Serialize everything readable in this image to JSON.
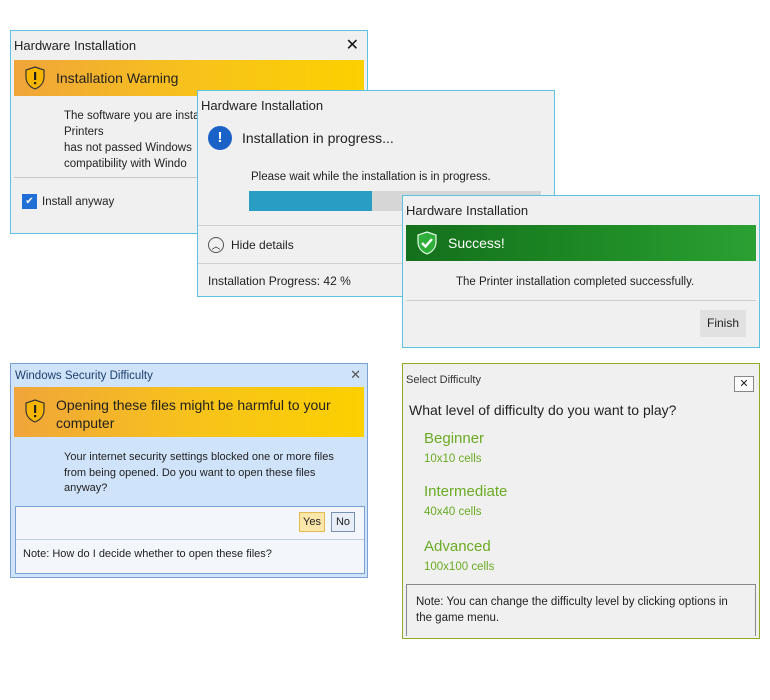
{
  "colors": {
    "warning_banner": "#f7c21c",
    "success_banner": "#1e8a25",
    "progress_fill": "#2a9dc4",
    "info_icon": "#1b62c8",
    "difficulty_accent": "#6bab24",
    "dialog_border": "#5bc3df"
  },
  "warning_dialog": {
    "title": "Hardware Installation",
    "close_icon": "close-icon",
    "banner_text": "Installation Warning",
    "banner_icon": "warning-shield-icon",
    "body_lines": [
      "The software you are insta",
      "Printers",
      "has not passed Windows",
      "compatibility with Windo"
    ],
    "checkbox_label": "Install anyway",
    "checkbox_checked": true
  },
  "progress_dialog": {
    "title": "Hardware Installation",
    "banner_icon": "info-icon",
    "banner_text": "Installation in progress...",
    "wait_text": "Please wait while the installation is in progress.",
    "progress": 0.42,
    "details_toggle": "Hide details",
    "progress_text": "Installation Progress: 42 %"
  },
  "success_dialog": {
    "title": "Hardware Installation",
    "banner_icon": "check-shield-icon",
    "banner_text": "Success!",
    "message": "The Printer installation completed successfully.",
    "finish_label": "Finish"
  },
  "security_dialog": {
    "title": "Windows Security Difficulty",
    "banner_text": "Opening these files might be harmful to your computer",
    "body": "Your internet security settings blocked one or more files from being opened. Do you want to open these files anyway?",
    "yes_label": "Yes",
    "no_label": "No",
    "note": "Note: How do I decide whether to open these files?"
  },
  "difficulty_dialog": {
    "title": "Select Difficulty",
    "question": "What level of difficulty do you want to play?",
    "options": [
      {
        "label": "Beginner",
        "size": "10x10 cells"
      },
      {
        "label": "Intermediate",
        "size": "40x40 cells"
      },
      {
        "label": "Advanced",
        "size": "100x100 cells"
      }
    ],
    "note": "Note: You can change the difficulty level by clicking options in the game menu."
  }
}
